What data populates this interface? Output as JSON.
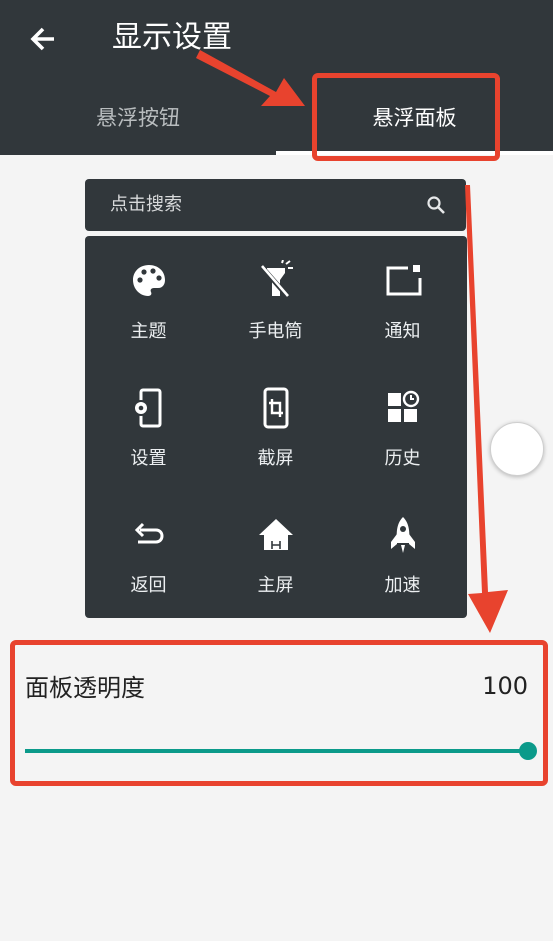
{
  "header": {
    "title": "显示设置",
    "back_icon": "arrow-left-icon"
  },
  "tabs": [
    {
      "label": "悬浮按钮",
      "selected": false
    },
    {
      "label": "悬浮面板",
      "selected": true
    }
  ],
  "search": {
    "placeholder": "点击搜索",
    "icon": "search-icon"
  },
  "grid": [
    {
      "label": "主题",
      "icon": "palette-icon"
    },
    {
      "label": "手电筒",
      "icon": "flashlight-off-icon"
    },
    {
      "label": "通知",
      "icon": "notification-icon"
    },
    {
      "label": "设置",
      "icon": "phone-settings-icon"
    },
    {
      "label": "截屏",
      "icon": "screenshot-crop-icon"
    },
    {
      "label": "历史",
      "icon": "history-icon"
    },
    {
      "label": "返回",
      "icon": "return-icon"
    },
    {
      "label": "主屏",
      "icon": "home-icon"
    },
    {
      "label": "加速",
      "icon": "rocket-icon"
    }
  ],
  "opacity": {
    "label": "面板透明度",
    "value": "100",
    "fraction": 1.0
  },
  "colors": {
    "appbar": "#31373b",
    "panel": "#31373b",
    "accent": "#0b9a8a",
    "annotation": "#e8432e"
  }
}
